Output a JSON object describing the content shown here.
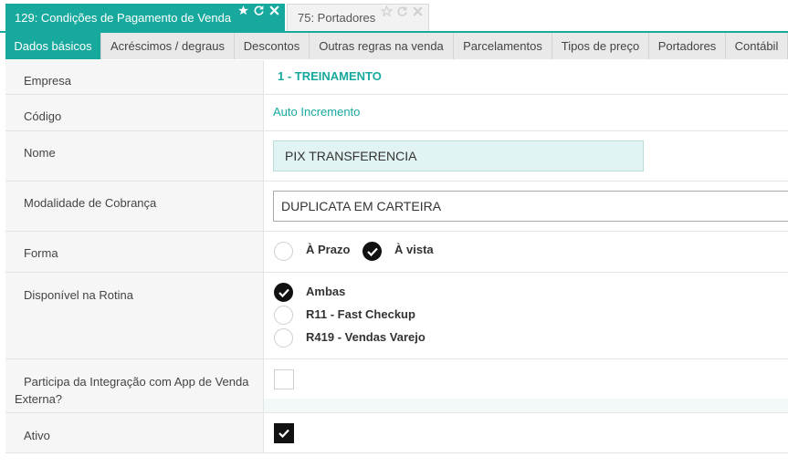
{
  "window_tabs": [
    {
      "label": "129: Condições de Pagamento de Venda",
      "active": true
    },
    {
      "label": "75: Portadores",
      "active": false
    }
  ],
  "section_tabs": [
    {
      "label": "Dados básicos",
      "active": true
    },
    {
      "label": "Acréscimos / degraus"
    },
    {
      "label": "Descontos"
    },
    {
      "label": "Outras regras na venda"
    },
    {
      "label": "Parcelamentos"
    },
    {
      "label": "Tipos de preço"
    },
    {
      "label": "Portadores"
    },
    {
      "label": "Contábil"
    }
  ],
  "form": {
    "empresa": {
      "label": "Empresa",
      "value": "1 - TREINAMENTO"
    },
    "codigo": {
      "label": "Código",
      "value": "Auto Incremento"
    },
    "nome": {
      "label": "Nome",
      "value": "PIX TRANSFERENCIA"
    },
    "modalidade": {
      "label": "Modalidade de Cobrança",
      "value": "DUPLICATA EM CARTEIRA"
    },
    "forma": {
      "label": "Forma",
      "options": [
        {
          "label": "À Prazo",
          "selected": false
        },
        {
          "label": "À vista",
          "selected": true
        }
      ]
    },
    "rotina": {
      "label": "Disponível na Rotina",
      "options": [
        {
          "label": "Ambas",
          "selected": true
        },
        {
          "label": "R11 - Fast Checkup",
          "selected": false
        },
        {
          "label": "R419 - Vendas Varejo",
          "selected": false
        }
      ]
    },
    "integracao": {
      "label_line1": "Participa da Integração com App de Venda",
      "label_line2": "Externa?",
      "checked": false
    },
    "ativo": {
      "label": "Ativo",
      "checked": true
    }
  },
  "colors": {
    "accent": "#17a99e",
    "label_bg": "#f6f6f6",
    "input_teal": "#e1f3f3"
  },
  "icons": [
    "star-icon",
    "refresh-icon",
    "close-icon",
    "check-icon"
  ]
}
